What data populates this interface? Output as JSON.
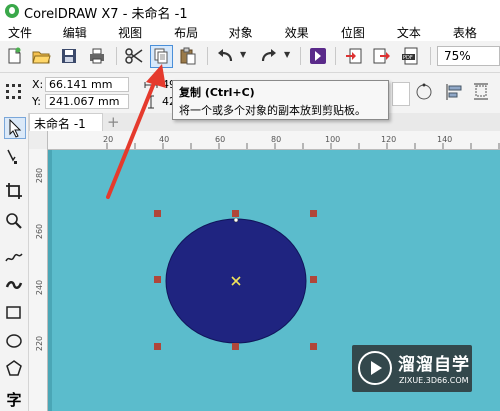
{
  "window": {
    "title": "CorelDRAW X7 - 未命名 -1"
  },
  "menubar": {
    "items": [
      "文件(F)",
      "编辑(E)",
      "视图(V)",
      "布局(L)",
      "对象(C)",
      "效果(C)",
      "位图(B)",
      "文本(X)",
      "表格(T)"
    ]
  },
  "toolbar": {
    "zoom": "75%"
  },
  "propbar": {
    "x_label": "X:",
    "x_value": "66.141 mm",
    "y_label": "Y:",
    "y_value": "241.067 mm",
    "w_partial": "49",
    "h_partial": "42"
  },
  "tooltip": {
    "title": "复制 (Ctrl+C)",
    "description": "将一个或多个对象的副本放到剪贴板。"
  },
  "tabs": {
    "doc": "未命名 -1",
    "add": "+"
  },
  "ruler": {
    "h_ticks": [
      "20",
      "40",
      "60",
      "80",
      "100",
      "120",
      "140"
    ],
    "v_ticks": [
      "280",
      "260",
      "240",
      "220"
    ]
  },
  "toolbox": {
    "text_tool": "字"
  },
  "colors": {
    "canvas_bg": "#5bbccc",
    "ellipse_fill": "#1f2480",
    "handle": "#b0463a",
    "arrow": "#e53a2d"
  },
  "watermark": {
    "name": "溜溜自学",
    "url": "ZIXUE.3D66.COM"
  }
}
